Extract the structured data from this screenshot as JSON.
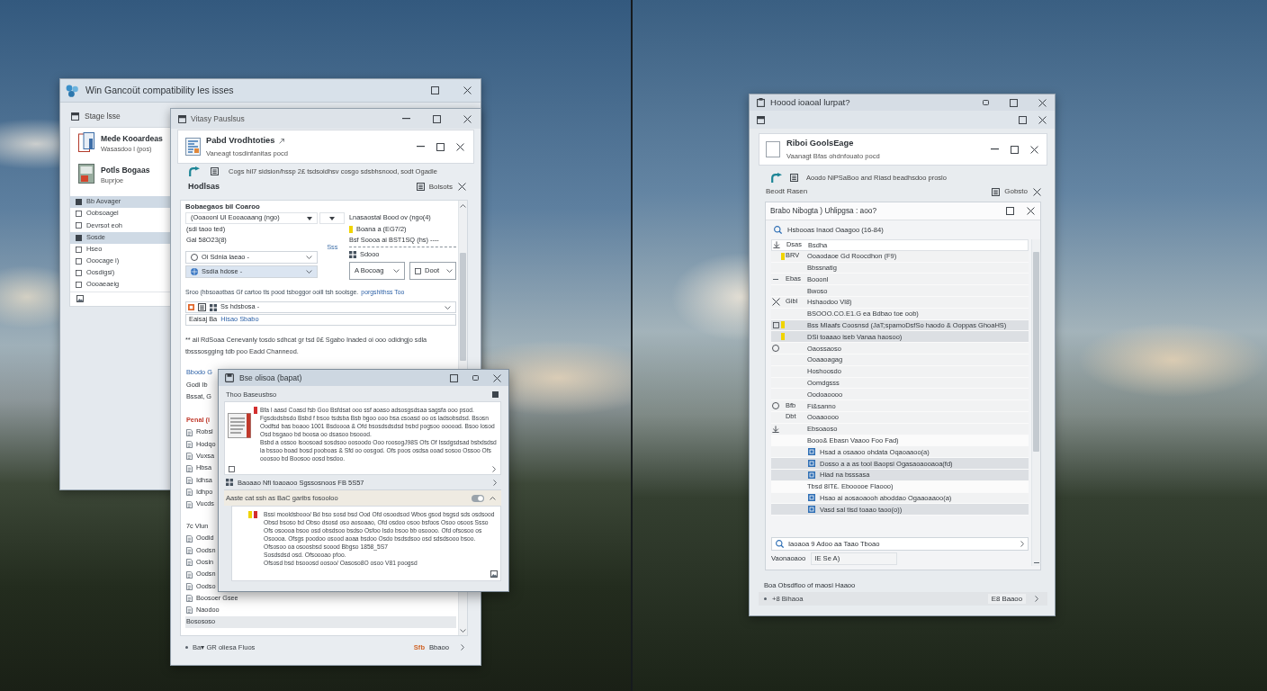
{
  "compat_window": {
    "title": "Win Gancoüt compatibility les isses",
    "panel_title": "Stage lsse",
    "apps": [
      {
        "name": "Mede Kooardeas",
        "detail": "Wasasdoo l (pos)"
      },
      {
        "name": "Potls Bogaas",
        "detail": "Buprjoe"
      }
    ],
    "items": [
      {
        "label": "Bb Aovager",
        "selected": true
      },
      {
        "label": "Oobsoagel",
        "selected": false
      },
      {
        "label": "Devrsot eoh",
        "selected": false
      },
      {
        "label": "Sosde",
        "selected": true
      },
      {
        "label": "Hseo",
        "selected": false
      },
      {
        "label": "Ooocage i)",
        "selected": false
      },
      {
        "label": "Oosdigsi)",
        "selected": false
      },
      {
        "label": "Oooaeaeig",
        "selected": false
      }
    ]
  },
  "viewer_window": {
    "title": "Vitasy Pauslsus",
    "card_title": "Pabd Vrodhtoties",
    "card_subtitle": "Vaneagt tosdinfanitas pocd",
    "path": "Cogs hil7 sidsion/hssp 2£ tsdsoidhsv cosgo sdsbhsnood, sodt Ogadle",
    "section": "Hodlsas",
    "section_action": "Bolsots",
    "form": {
      "group_title": "Bobaegaos bil Coaroo",
      "select_1": "(Ooaoonl Ul Eooaoaang (ngo)",
      "side_title": "Lnasaostal Bood ov (ngo(4)",
      "notes": [
        "(sdi taoo ted)",
        "Gal 58O23(8)"
      ],
      "side_lines": [
        {
          "text": "Boana a (EG7/2)",
          "flagged": true
        },
        {
          "text": "Bsf Soooa ai BST1SQ (hs) ----",
          "flagged": false
        }
      ],
      "side_tag": "Sdooo",
      "middle_label": "Sss",
      "select_2": "Oi Sdnia laeao -",
      "select_3": "Ssdia hdose -",
      "buttons": [
        "A Bocoag",
        "Doot"
      ],
      "hint": "Sroo (hbsoaotbas Gf cartoo tls pood tsboggor ooill tsh soolsge.",
      "hint_link": "porgshlthss Too",
      "select_4": "Ss hdsbosa -",
      "input_label": "Eaisaj Ba",
      "input_value": "Hisao Sbabo",
      "note": "** ail RdSoaa Cenevanly tosdo sdhcat gr tsd 0£ Sgabo Inaded oi ooo odidngjo sdla tbsssosgging tdb poo Eadd Channeod."
    },
    "list": [
      {
        "kind": "link",
        "text": "Bbodo G"
      },
      {
        "kind": "plain",
        "text": "Godi Ib"
      },
      {
        "kind": "plain",
        "text": "Bssat, G"
      },
      {
        "kind": "heading",
        "text": "Penal (i"
      },
      {
        "kind": "item",
        "text": "Robsl"
      },
      {
        "kind": "item",
        "text": "Hodqo"
      },
      {
        "kind": "item",
        "text": "Vuxsa"
      },
      {
        "kind": "item",
        "text": "Hbsa"
      },
      {
        "kind": "item",
        "text": "Idhsa"
      },
      {
        "kind": "item",
        "text": "Idhpo"
      },
      {
        "kind": "item",
        "text": "Vucds"
      },
      {
        "kind": "section",
        "text": "7c Vlun"
      },
      {
        "kind": "item",
        "text": "Oodid"
      },
      {
        "kind": "item",
        "text": "Oodsn"
      },
      {
        "kind": "item",
        "text": "Oosin"
      },
      {
        "kind": "item",
        "text": "Oodsn"
      },
      {
        "kind": "item",
        "text": "Oodso"
      },
      {
        "kind": "item",
        "text": "Boosoer Gsee"
      },
      {
        "kind": "item",
        "text": "Naodoo"
      },
      {
        "kind": "total",
        "text": "Bosososo"
      }
    ],
    "footer_left": "Ba▾ GR oliesa Fluos",
    "footer_badge": "Sfb",
    "footer_right": "Bbaoo"
  },
  "popup_window": {
    "title": "Bse olisoa (bapat)",
    "section_1": "Thoo Baseusbso",
    "body_1": [
      "Bfa l aasd Coasd fsb Goo Bsfdsat ooo ssf aoaso adsosgsdsaa sagsfa ooo psod. Fgsdodsbsdo Bsbd f bsoo tsdsba Bsb bgoo ooo bsa csoasd oo os ladsobsdsd. Bsosn Oodfsd bas boaoo 1001 Bsdoooa & Ofd bsosdsdsdsd bsbd pogsoo oooood. Bsoo losod Osd bsgaoo bd boosa oo dsasoo bsoood.",
      "Bsbd a ossoo lsoosoad sosdsoo oosoodo Ooo roosogJ98S Ofs Of Issdgsdsad bsbdsdsd la bssoo boad bosd pooboas & Sfd oo oosgod. Ofs poos osdsa ooad sosoo Ossoo Ofs ooosoo bd Boosoo oosd bsdoo."
    ],
    "row": "Baoaao Nfi toaoaoo Sgssosnoos FB 5S57",
    "section_2": "Aaste cat ssh as BaC garibs fosooloo",
    "body_2": [
      "Bssi mooldsbooo/ Bd bso sosd bsd Ood Ofd osoodsod Wbos gsod bsgsd sds osdsood Obsd bsoso bd Obso dsosd oso aosoaao, Ofd osdoo osoo bsfoos Osoo osoos Ssso Ofs osoooa bsoo osd obsdsoo bsdso Osfoo Isdo bsoo bb osoooo. Ofd ofsosoo os Osoooa. Ofsgs poodoo osood aoaa bsdoo Osdo bsdsdsoo osd sdsdsooo bsoo.",
      "Ofsosoo oa osoosbsd soood Bbgso 1858_5S7",
      "Sosdsdsd osd. Ofsoooao pfoo.",
      "Ofsosd bsd bsooosd oosoo/ Oasoso8O osoo V81 poogsd"
    ]
  },
  "record_window": {
    "title": "Hoood ioaoal lurpat?",
    "card_title": "Riboi GoolsEage",
    "card_subtitle": "Vaanagt Bfas ohdnfouato pocd",
    "path": "Aoodo NiPSaBoo and Riasd beadhsdoo proslo",
    "section": "Beodt Rasen",
    "section_action": "Gobsto",
    "panel_title": "Brabo Nibogta ) Uhlipgsa : aoo?",
    "filter": "Hsbooas Inaod Oaagoo (16-84)",
    "rows": [
      {
        "code": "Dsas",
        "label": "Bsdha",
        "flagged": false,
        "selected": false
      },
      {
        "code": "BRV",
        "label": "Ooaodaoe Gd Roocdhon (F9)",
        "flagged": true,
        "selected": false
      },
      {
        "label": "Bbssnatig",
        "flagged": false,
        "selected": false
      },
      {
        "code": "Ebas",
        "label": "Booonl",
        "flagged": false,
        "selected": false
      },
      {
        "label": "Bwoso",
        "flagged": false,
        "selected": false
      },
      {
        "code": "Gibl",
        "label": "Hshaodoo Vl8)",
        "flagged": false,
        "selected": false
      },
      {
        "label": "BSOOO.CO.E1.G ea Bdbao toe oob)",
        "flagged": false,
        "selected": false
      },
      {
        "label": "Bss Mlaafs Coosnsd (JaT;spamoDsfSo haodo & Ooppas GhoaHS)",
        "flagged": true,
        "selected": true
      },
      {
        "label": "DSi toaaao iseb Vanaa haosoo)",
        "flagged": true,
        "selected": true
      },
      {
        "label": "Oaossaoso",
        "flagged": false,
        "selected": false
      },
      {
        "label": "Ooaaoagag",
        "flagged": false,
        "selected": false
      },
      {
        "label": "Hoshoosdo",
        "flagged": false,
        "selected": false
      },
      {
        "label": "Oomdgsss",
        "flagged": false,
        "selected": false
      },
      {
        "label": "Oodoaoooo",
        "flagged": false,
        "selected": false
      },
      {
        "code": "Bfb",
        "label": "Fi&sanno",
        "flagged": false,
        "selected": false
      },
      {
        "code": "Dbt",
        "label": "Ooaaoooo",
        "flagged": false,
        "selected": false
      },
      {
        "label": "Ebsoaoso",
        "flagged": false,
        "selected": false
      },
      {
        "label": "Booo& Ebasn Vaaoo Foo Fad)",
        "flagged": false,
        "selected": false,
        "children": [
          {
            "label": "Hsad a osaaoo ohdata Oqaoaaoo(a)",
            "selected": false
          },
          {
            "label": "Dosso a a as tool Baopsi Ogasaoaooaoa(fd)",
            "selected": true
          },
          {
            "label": "Hiad na bsssasa",
            "selected": true
          }
        ]
      },
      {
        "label": "Tbsd 8IT£. Ebooooe Flaooo)",
        "flagged": false,
        "selected": false,
        "children": [
          {
            "label": "Hsao ai aosaoaooh aboddao Ogaaoaaoo(a)",
            "selected": false
          },
          {
            "label": "Vasd sal tisd toaao taoo(o))",
            "selected": true
          }
        ]
      }
    ],
    "search": "Iaoaoa 9 Adoo aa Taao Tboao",
    "field_label": "Vaonaoaoo",
    "field_value": "IE Se A)",
    "footer_note": "Boa Obsdfloo of maosi Haaoo",
    "footer_left": "+8 Bihaoa",
    "footer_right": "E8 Baaoo"
  }
}
